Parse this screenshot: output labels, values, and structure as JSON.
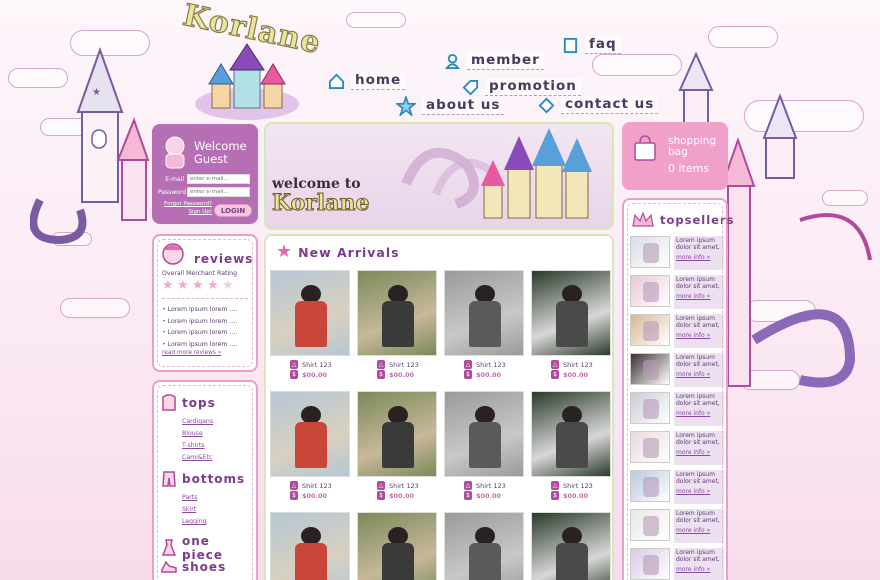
{
  "brand": {
    "logo_text": "Korlane"
  },
  "nav": {
    "home": "home",
    "member": "member",
    "faq": "faq",
    "promotion": "promotion",
    "about": "about us",
    "contact": "contact us"
  },
  "login": {
    "title_1": "Welcome",
    "title_2": "Guest",
    "email_label": "E-mail",
    "password_label": "Password",
    "email_placeholder": "enter e-mail...",
    "password_placeholder": "enter e-mail...",
    "forgot_1": "Forgot Password?",
    "forgot_2": "Sign Up!",
    "login_button": "LOGIN"
  },
  "reviews": {
    "title": "reviews",
    "rating_label": "Overall Merchant Rating",
    "stars_filled": 4,
    "stars_total": 5,
    "items": [
      "Lorem ipsum lorem ....",
      "Lorem ipsum lorem ....",
      "Lorem ipsum lorem ....",
      "Lorem ipsum lorem ...."
    ],
    "more": "read more reviews »"
  },
  "categories": [
    {
      "title": "tops",
      "links": [
        "Cardigans",
        "Blouse",
        "T-shirts",
        "Cami&Etc"
      ]
    },
    {
      "title": "bottoms",
      "links": [
        "Parts",
        "Skirt",
        "Legging"
      ]
    },
    {
      "title": "one piece",
      "links": []
    },
    {
      "title": "shoes",
      "links": []
    }
  ],
  "banner": {
    "line1": "welcome to",
    "line2": "Korlane"
  },
  "arrivals": {
    "title": "New Arrivals",
    "products": [
      {
        "name": "Shirt 123",
        "price": "$00.00"
      },
      {
        "name": "Shirt 123",
        "price": "$00.00"
      },
      {
        "name": "Shirt 123",
        "price": "$00.00"
      },
      {
        "name": "Shirt 123",
        "price": "$00.00"
      },
      {
        "name": "Shirt 123",
        "price": "$00.00"
      },
      {
        "name": "Shirt 123",
        "price": "$00.00"
      },
      {
        "name": "Shirt 123",
        "price": "$00.00"
      },
      {
        "name": "Shirt 123",
        "price": "$00.00"
      },
      {
        "name": "",
        "price": ""
      },
      {
        "name": "",
        "price": ""
      },
      {
        "name": "",
        "price": ""
      },
      {
        "name": "",
        "price": ""
      }
    ]
  },
  "bag": {
    "title_1": "shopping",
    "title_2": "bag",
    "items": "0 items"
  },
  "topsellers": {
    "title": "topsellers",
    "items": [
      {
        "line1": "Lorem ipsum",
        "line2": "dolor sit amet,",
        "more": "more info »"
      },
      {
        "line1": "Lorem ipsum",
        "line2": "dolor sit amet,",
        "more": "more info »"
      },
      {
        "line1": "Lorem ipsum",
        "line2": "dolor sit amet,",
        "more": "more info »"
      },
      {
        "line1": "Lorem ipsum",
        "line2": "dolor sit amet,",
        "more": "more info »"
      },
      {
        "line1": "Lorem ipsum",
        "line2": "dolor sit amet,",
        "more": "more info »"
      },
      {
        "line1": "Lorem ipsum",
        "line2": "dolor sit amet,",
        "more": "more info »"
      },
      {
        "line1": "Lorem ipsum",
        "line2": "dolor sit amet,",
        "more": "more info »"
      },
      {
        "line1": "Lorem ipsum",
        "line2": "dolor sit amet,",
        "more": "more info »"
      },
      {
        "line1": "Lorem ipsum",
        "line2": "dolor sit amet,",
        "more": "more info »"
      }
    ]
  },
  "colors": {
    "accent_purple": "#b66fb5",
    "accent_pink": "#f0a0c9",
    "text": "#5a3d6e",
    "link": "#8a4aa0"
  }
}
